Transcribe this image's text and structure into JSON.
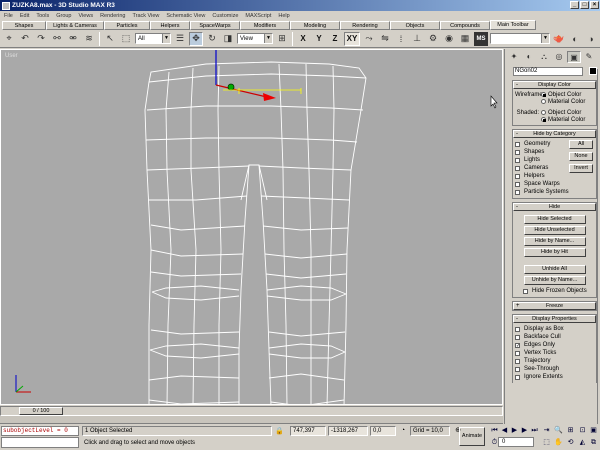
{
  "window": {
    "title": "ZUZKA8.max - 3D Studio MAX R3"
  },
  "menu": [
    "File",
    "Edit",
    "Tools",
    "Group",
    "Views",
    "Rendering",
    "Track View",
    "Schematic View",
    "Customize",
    "MAXScript",
    "Help"
  ],
  "tabs": [
    "Shapes",
    "Lights & Cameras",
    "Particles",
    "Helpers",
    "SpaceWarps",
    "Modifiers",
    "Modeling",
    "Rendering",
    "Objects",
    "Compounds",
    "Main Toolbar"
  ],
  "toolbar": {
    "selection_filter": "All",
    "ref_coord": "View",
    "axes": [
      "X",
      "Y",
      "Z",
      "XY"
    ],
    "named_selection": ""
  },
  "viewport": {
    "label": "User"
  },
  "timeline": {
    "position": "0 / 100"
  },
  "status": {
    "maxscript": "subobjectLevel = 0",
    "selection": "1 Object Selected",
    "prompt": "Click and drag to select and move objects",
    "x": "747,397",
    "y": "-1318,267",
    "z": "0,0",
    "grid": "Grid = 10,0",
    "animate": "Animate",
    "frame": "0"
  },
  "command_panel": {
    "object_name": "NGon02",
    "object_color": "#000000",
    "rollouts": {
      "display_color": {
        "title": "Display Color",
        "wireframe_label": "Wireframe:",
        "shaded_label": "Shaded:",
        "object_color": "Object Color",
        "material_color": "Material Color"
      },
      "hide_by_category": {
        "title": "Hide by Category",
        "items": [
          "Geometry",
          "Shapes",
          "Lights",
          "Cameras",
          "Helpers",
          "Space Warps",
          "Particle Systems"
        ],
        "buttons": [
          "All",
          "None",
          "Invert"
        ]
      },
      "hide": {
        "title": "Hide",
        "buttons": [
          "Hide Selected",
          "Hide Unselected",
          "Hide by Name...",
          "Hide by Hit",
          "Unhide All",
          "Unhide by Name..."
        ],
        "hide_frozen": "Hide Frozen Objects"
      },
      "freeze": {
        "title": "Freeze"
      },
      "display_properties": {
        "title": "Display Properties",
        "items": [
          "Display as Box",
          "Backface Cull",
          "Edges Only",
          "Vertex Ticks",
          "Trajectory",
          "See-Through",
          "Ignore Extents"
        ],
        "checked": [
          false,
          false,
          true,
          false,
          false,
          false,
          false
        ]
      }
    }
  }
}
